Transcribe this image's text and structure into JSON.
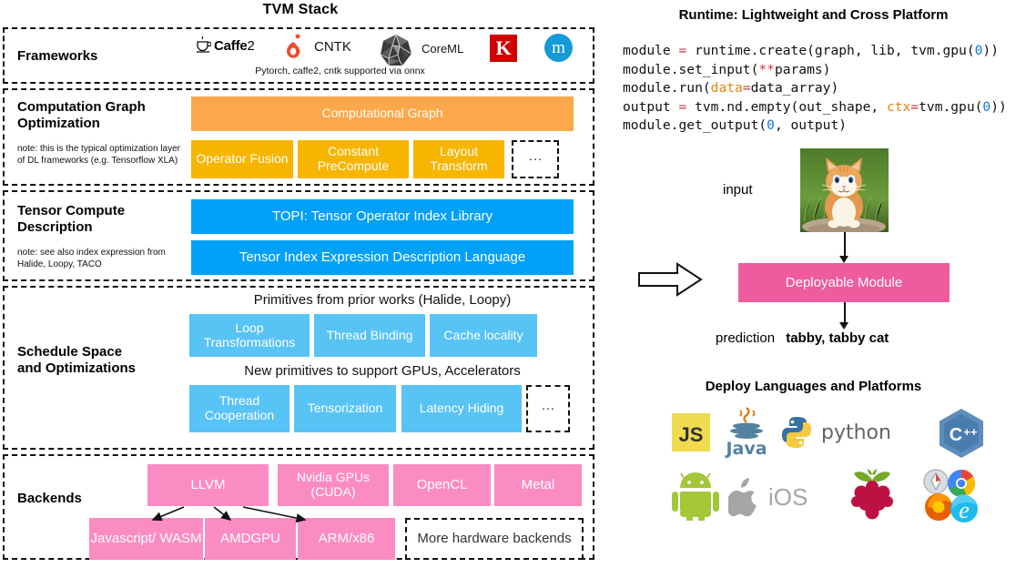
{
  "stack": {
    "title": "TVM Stack",
    "layers": [
      {
        "label": "Frameworks",
        "frameworks": [
          {
            "name": "caffe2",
            "text": "Caffe",
            "suffix": "2"
          },
          {
            "name": "pytorch",
            "text": ""
          },
          {
            "name": "cntk",
            "text": "CNTK"
          },
          {
            "name": "onnx",
            "text": ""
          },
          {
            "name": "coreml",
            "text": "CoreML"
          },
          {
            "name": "keras",
            "text": "K"
          },
          {
            "name": "mxnet",
            "text": "m"
          }
        ],
        "note": "Pytorch, caffe2, cntk supported via onnx"
      },
      {
        "label_line1": "Computation Graph",
        "label_line2": "Optimization",
        "note": "note: this is the typical optimization layer of DL frameworks (e.g. Tensorflow XLA)",
        "main_box": "Computational Graph",
        "boxes": [
          "Operator Fusion",
          "Constant PreCompute",
          "Layout Transform",
          "···"
        ]
      },
      {
        "label_line1": "Tensor Compute",
        "label_line2": "Description",
        "note": "note: see also index expression from Halide, Loopy, TACO",
        "boxes": [
          "TOPI: Tensor Operator Index Library",
          "Tensor Index Expression Description Language"
        ]
      },
      {
        "label_line1": "Schedule Space",
        "label_line2": "and Optimizations",
        "caption1": "Primitives from prior works (Halide, Loopy)",
        "row1": [
          "Loop Transformations",
          "Thread Binding",
          "Cache locality"
        ],
        "caption2": "New primitives to support GPUs, Accelerators",
        "row2": [
          "Thread Cooperation",
          "Tensorization",
          "Latency Hiding",
          "···"
        ]
      },
      {
        "label": "Backends",
        "row1": [
          "LLVM",
          "Nvidia GPUs (CUDA)",
          "OpenCL",
          "Metal"
        ],
        "row2": [
          "Javascript/ WASM",
          "AMDGPU",
          "ARM/x86",
          "More hardware backends"
        ]
      }
    ]
  },
  "runtime": {
    "title": "Runtime: Lightweight and Cross Platform",
    "code_lines": [
      "module = runtime.create(graph, lib, tvm.gpu(0))",
      "module.set_input(**params)",
      "module.run(data=data_array)",
      "output = tvm.nd.empty(out_shape, ctx=tvm.gpu(0))",
      "module.get_output(0, output)"
    ],
    "input_label": "input",
    "deployable_module": "Deployable Module",
    "prediction_label": "prediction",
    "prediction_value": "tabby, tabby cat"
  },
  "deploy": {
    "title": "Deploy Languages and Platforms",
    "items": [
      {
        "name": "javascript",
        "text": "JS"
      },
      {
        "name": "java",
        "text": "Java"
      },
      {
        "name": "python",
        "text": "python"
      },
      {
        "name": "cplusplus",
        "text": "C++"
      },
      {
        "name": "android",
        "text": ""
      },
      {
        "name": "ios",
        "text": "iOS"
      },
      {
        "name": "raspberry-pi",
        "text": ""
      },
      {
        "name": "browsers",
        "text": ""
      }
    ]
  },
  "colors": {
    "orange_main": "#FAA council",
    "orange": "#FBA84A",
    "gold": "#F7B500",
    "blue": "#03A0F7",
    "light_blue": "#58C3F5",
    "pink": "#FB8CC3",
    "pink_dark": "#EE5B9E"
  }
}
